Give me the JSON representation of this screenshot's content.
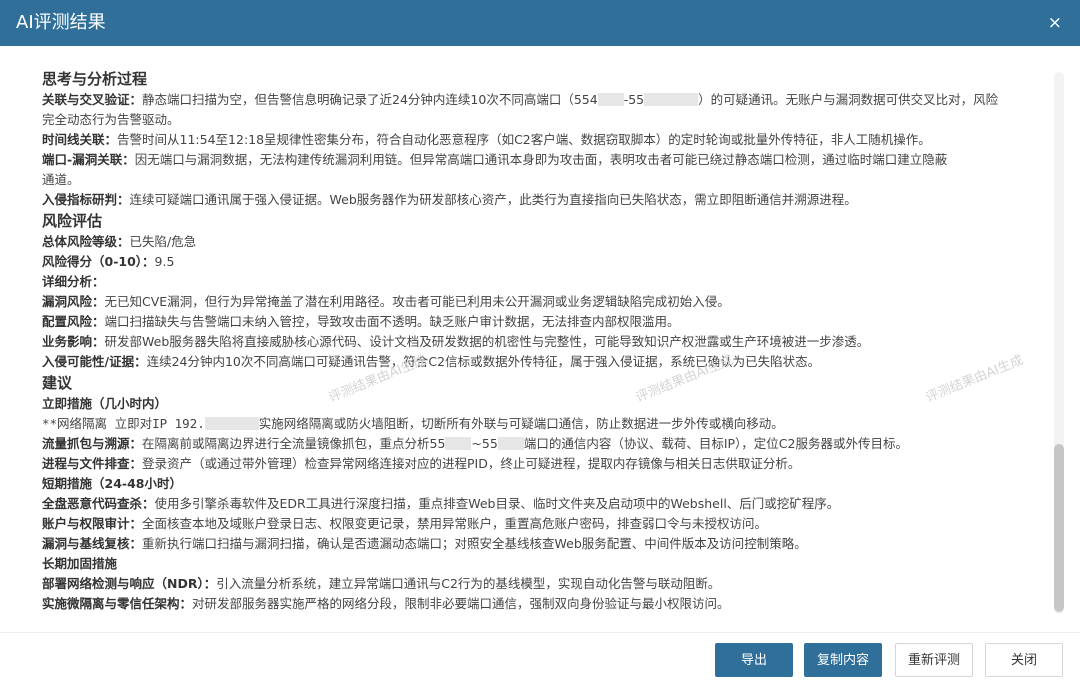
{
  "dialog": {
    "title": "AI评测结果",
    "close_icon": "×"
  },
  "sections": {
    "thinking": {
      "heading": "思考与分析过程",
      "l1_label": "关联与交叉验证：",
      "l1_a": "静态端口扫描为空，但告警信息明确记录了近24分钟内连续10次不同高端口（554",
      "l1_b": "-55",
      "l1_c": "）的可疑通讯。无账户与漏洞数据可供交叉比对，风险",
      "l1_cont": "完全动态行为告警驱动。",
      "l2_label": "时间线关联：",
      "l2_text": "告警时间从11:54至12:18呈规律性密集分布，符合自动化恶意程序（如C2客户端、数据窃取脚本）的定时轮询或批量外传特征，非人工随机操作。",
      "l3_label": "端口-漏洞关联：",
      "l3_text": "因无端口与漏洞数据，无法构建传统漏洞利用链。但异常高端口通讯本身即为攻击面，表明攻击者可能已绕过静态端口检测，通过临时端口建立隐蔽",
      "l3_cont": "通道。",
      "l4_label": "入侵指标研判：",
      "l4_text": "连续可疑端口通讯属于强入侵证据。Web服务器作为研发部核心资产，此类行为直接指向已失陷状态，需立即阻断通信并溯源进程。"
    },
    "risk": {
      "heading": "风险评估",
      "level_label": "总体风险等级：",
      "level_value": "已失陷/危急",
      "score_label": "风险得分（0-10）：",
      "score_value": "9.5",
      "detail_label": "详细分析：",
      "vuln_label": "漏洞风险：",
      "vuln_text": "无已知CVE漏洞，但行为异常掩盖了潜在利用路径。攻击者可能已利用未公开漏洞或业务逻辑缺陷完成初始入侵。",
      "config_label": "配置风险：",
      "config_text": "端口扫描缺失与告警端口未纳入管控，导致攻击面不透明。缺乏账户审计数据，无法排查内部权限滥用。",
      "biz_label": "业务影响：",
      "biz_text": "研发部Web服务器失陷将直接威胁核心源代码、设计文档及研发数据的机密性与完整性，可能导致知识产权泄露或生产环境被进一步渗透。",
      "poss_label": "入侵可能性/证据：",
      "poss_text": "连续24分钟内10次不同高端口可疑通讯告警，符合C2信标或数据外传特征，属于强入侵证据，系统已确认为已失陷状态。"
    },
    "advice": {
      "heading": "建议",
      "imm_heading": "立即措施（几小时内）",
      "iso_text_a": "**网络隔离 立即对IP 192.",
      "iso_text_b": "实施网络隔离或防火墙阻断，切断所有外联与可疑端口通信，防止数据进一步外传或横向移动。",
      "cap_label": "流量抓包与溯源：",
      "cap_text_a": "在隔离前或隔离边界进行全流量镜像抓包，重点分析55",
      "cap_text_b": "~55",
      "cap_text_c": "端口的通信内容（协议、载荷、目标IP），定位C2服务器或外传目标。",
      "proc_label": "进程与文件排查：",
      "proc_text": "登录资产（或通过带外管理）检查异常网络连接对应的进程PID，终止可疑进程，提取内存镜像与相关日志供取证分析。",
      "short_heading": "短期措施（24-48小时）",
      "scan_label": "全盘恶意代码查杀：",
      "scan_text": "使用多引擎杀毒软件及EDR工具进行深度扫描，重点排查Web目录、临时文件夹及启动项中的Webshell、后门或挖矿程序。",
      "acct_label": "账户与权限审计：",
      "acct_text": "全面核查本地及域账户登录日志、权限变更记录，禁用异常账户，重置高危账户密码，排查弱口令与未授权访问。",
      "base_label": "漏洞与基线复核：",
      "base_text": "重新执行端口扫描与漏洞扫描，确认是否遗漏动态端口；对照安全基线核查Web服务配置、中间件版本及访问控制策略。",
      "long_heading": "长期加固措施",
      "ndr_label": "部署网络检测与响应（NDR）：",
      "ndr_text": "引入流量分析系统，建立异常端口通讯与C2行为的基线模型，实现自动化告警与联动阻断。",
      "zt_label": "实施微隔离与零信任架构：",
      "zt_text": "对研发部服务器实施严格的网络分段，限制非必要端口通信，强制双向身份验证与最小权限访问。"
    }
  },
  "watermark": "评测结果由AI生成",
  "buttons": {
    "export": "导出",
    "copy": "复制内容",
    "reevaluate": "重新评测",
    "close": "关闭"
  }
}
